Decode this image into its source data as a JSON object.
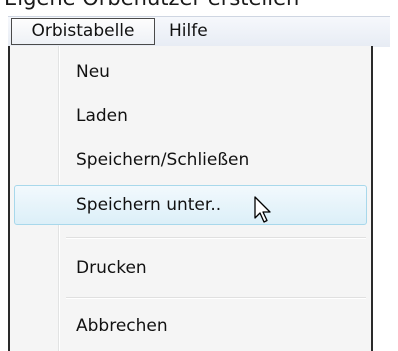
{
  "page_title_partial": "Eigene Orbenutzer erstellen",
  "menubar": {
    "items": [
      {
        "label": "Orbistabelle",
        "active": true
      },
      {
        "label": "Hilfe",
        "active": false
      }
    ]
  },
  "dropdown": {
    "items": [
      {
        "label": "Neu"
      },
      {
        "label": "Laden"
      },
      {
        "label": "Speichern/Schließen"
      },
      {
        "label": "Speichern unter..",
        "hovered": true
      },
      {
        "label": "Drucken"
      },
      {
        "label": "Abbrechen"
      }
    ]
  },
  "cursor": {
    "icon": "arrow-pointer-icon"
  }
}
